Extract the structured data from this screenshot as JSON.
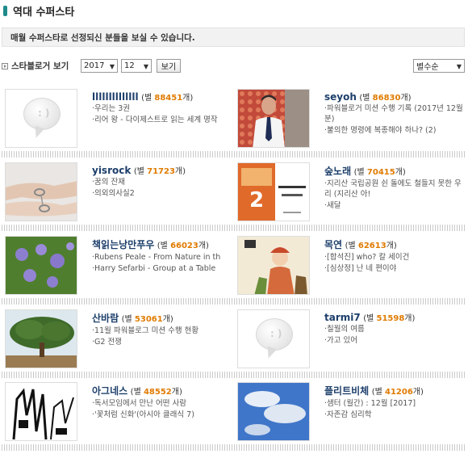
{
  "page": {
    "title": "역대 수퍼스타",
    "notice": "매월 수퍼스타로 선정되신 분들을 보실 수 있습니다."
  },
  "filter": {
    "label": "스타블로거 보기",
    "year": "2017",
    "month": "12",
    "button": "보기",
    "sort": "별수순"
  },
  "bloggers": [
    {
      "name": "llllllllllllll",
      "stars_prefix": "(별 ",
      "stars": "88451",
      "stars_suffix": "개)",
      "posts": [
        "·우리는 3권",
        "·리어 왕 - 다이제스트로 읽는 세계 명작"
      ],
      "thumb": "placeholder-bubble"
    },
    {
      "name": "seyoh",
      "stars_prefix": "(별 ",
      "stars": "86830",
      "stars_suffix": "개)",
      "posts": [
        "·파워블로거 미션 수행 기록 (2017년 12월분)",
        "·불의한 명령에 복종해야 하나? (2)"
      ],
      "thumb": "man-photo"
    },
    {
      "name": "yisrock",
      "stars_prefix": "(별 ",
      "stars": "71723",
      "stars_suffix": "개)",
      "posts": [
        "·꿈의 잔재",
        "·의외의사실2"
      ],
      "thumb": "handcuffs-photo"
    },
    {
      "name": "숲노래",
      "stars_prefix": "(별 ",
      "stars": "70415",
      "stars_suffix": "개)",
      "posts": [
        "·지리산 국립공원 쉰 돌에도 철들지 못한 우리 (지리산 아!",
        "·새달"
      ],
      "thumb": "book-cover"
    },
    {
      "name": "책읽는낭만푸우",
      "stars_prefix": "(별 ",
      "stars": "66023",
      "stars_suffix": "개)",
      "posts": [
        "·Rubens Peale - From Nature in th",
        "·Harry Sefarbi - Group at a Table"
      ],
      "thumb": "flowers-photo"
    },
    {
      "name": "목연",
      "stars_prefix": "(별 ",
      "stars": "62613",
      "stars_suffix": "개)",
      "posts": [
        "·[합석진] who? 칼 세이건",
        "·[심상정] 난 네 편이야"
      ],
      "thumb": "cartoon-illustration"
    },
    {
      "name": "산바람",
      "stars_prefix": "(별 ",
      "stars": "53061",
      "stars_suffix": "개)",
      "posts": [
        "·11월 파워블로그 미션 수행 현황",
        "·G2 전쟁"
      ],
      "thumb": "tree-photo"
    },
    {
      "name": "tarmi7",
      "stars_prefix": "(별 ",
      "stars": "51598",
      "stars_suffix": "개)",
      "posts": [
        "·칠월의 여름",
        "·가고 있어"
      ],
      "thumb": "placeholder-bubble"
    },
    {
      "name": "아그네스",
      "stars_prefix": "(별 ",
      "stars": "48552",
      "stars_suffix": "개)",
      "posts": [
        "·독서모임에서 만난 어떤 사람",
        "·'꽃처럼 신화'(아시아 클래식 7)"
      ],
      "thumb": "sketch-drawing"
    },
    {
      "name": "플리트비체",
      "stars_prefix": "(별 ",
      "stars": "41206",
      "stars_suffix": "개)",
      "posts": [
        "·샘터 (월간) : 12월 [2017]",
        "·자존감 심리학"
      ],
      "thumb": "sky-clouds-photo"
    }
  ]
}
